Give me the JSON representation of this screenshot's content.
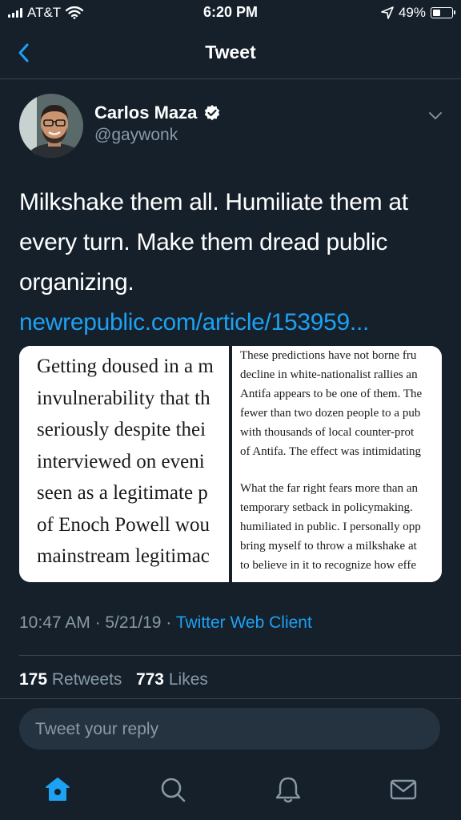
{
  "status_bar": {
    "carrier": "AT&T",
    "time": "6:20 PM",
    "battery": "49%",
    "battery_level": 0.49
  },
  "nav": {
    "title": "Tweet"
  },
  "tweet": {
    "author_name": "Carlos Maza",
    "author_handle": "@gaywonk",
    "text": "Milkshake them all. Humiliate them at every turn. Make them dread public organizing. ",
    "link": "newrepublic.com/article/153959...",
    "media": {
      "left_lines": [
        "Getting doused in a m",
        "invulnerability that th",
        "seriously despite thei",
        "interviewed on eveni",
        "seen as a legitimate p",
        "of Enoch Powell wou",
        "mainstream legitimac"
      ],
      "right_lines": [
        "These predictions have not borne fru",
        "decline in white-nationalist rallies an",
        "Antifa appears to be one of them. The",
        "fewer than two dozen people to a pub",
        "with thousands of local counter-prot",
        "of Antifa. The effect was intimidating",
        "What the far right fears more than an",
        "temporary setback in policymaking.",
        "humiliated in public. I personally opp",
        "bring myself to throw a milkshake at",
        "to believe in it to recognize how effe"
      ]
    },
    "time": "10:47 AM",
    "date": "5/21/19",
    "separator": "·",
    "client": "Twitter Web Client",
    "retweets_count": "175",
    "retweets_label": "Retweets",
    "likes_count": "773",
    "likes_label": "Likes"
  },
  "reply": {
    "placeholder": "Tweet your reply"
  },
  "tabbar": {
    "items": [
      {
        "name": "home-icon",
        "active": true
      },
      {
        "name": "search-icon",
        "active": false
      },
      {
        "name": "notifications-icon",
        "active": false
      },
      {
        "name": "messages-icon",
        "active": false
      }
    ]
  },
  "colors": {
    "background": "#15202b",
    "accent": "#1da1f2",
    "secondary_text": "#8899a6",
    "divider": "#38444d"
  }
}
